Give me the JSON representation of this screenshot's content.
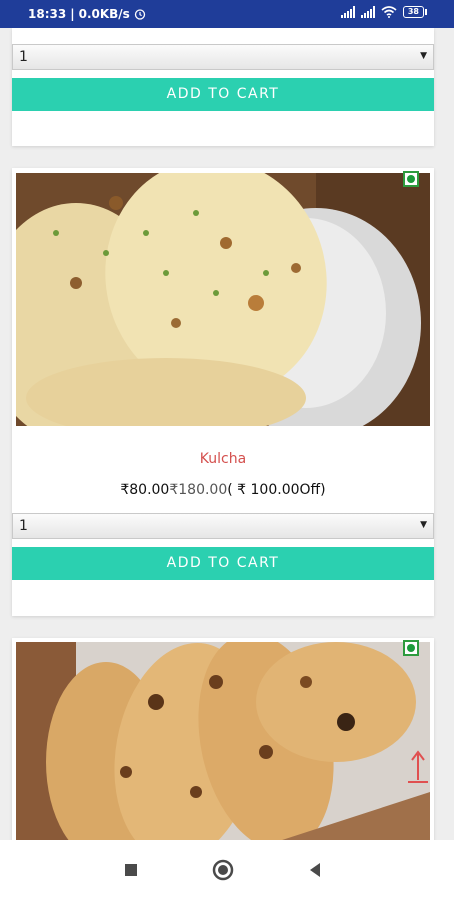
{
  "status_bar": {
    "time": "18:33",
    "network_speed": "0.0KB/s",
    "battery": "38"
  },
  "products": [
    {
      "quantity": "1",
      "add_to_cart_label": "ADD TO CART"
    },
    {
      "name": "Kulcha",
      "price": "₹80.00",
      "mrp": "₹180.00",
      "discount": "( ₹ 100.00Off)",
      "quantity": "1",
      "add_to_cart_label": "ADD TO CART"
    },
    {
      "name": "",
      "price": "",
      "image": "naan-bread"
    }
  ],
  "colors": {
    "status_bar": "#1f3d99",
    "add_to_cart": "#2bd0b0",
    "product_name": "#d4504e",
    "veg_mark": "#1c9b3b"
  }
}
